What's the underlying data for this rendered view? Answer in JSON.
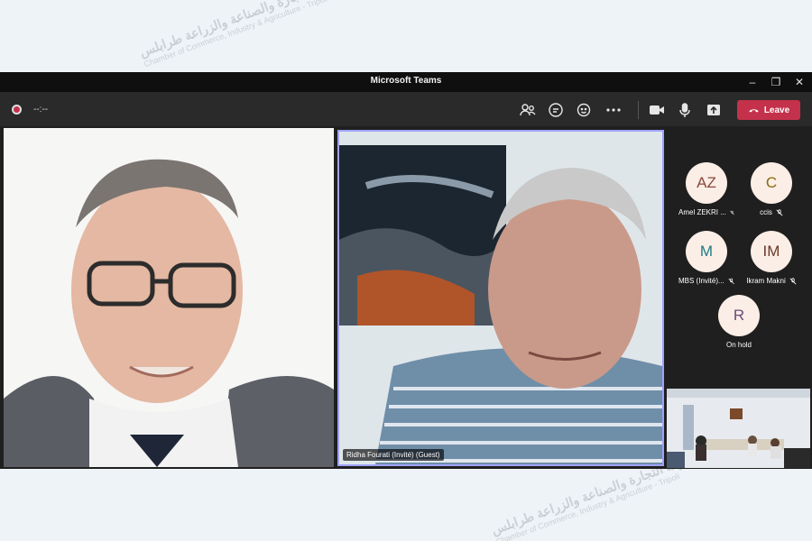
{
  "window": {
    "title": "Microsoft Teams"
  },
  "toolbar": {
    "timer": "--:--",
    "leave_label": "Leave",
    "icons": [
      "people-icon",
      "chat-icon",
      "reactions-icon",
      "more-icon",
      "camera-icon",
      "mic-icon",
      "share-icon"
    ]
  },
  "tiles": {
    "center_name": "Ridha Fourati (Invité) (Guest)"
  },
  "participants": [
    {
      "initials": "AZ",
      "name": "Amel ZEKRI ...",
      "color": "#8a4a3c",
      "muted": true
    },
    {
      "initials": "C",
      "name": "ccis",
      "color": "#8c6a12",
      "muted": true
    },
    {
      "initials": "M",
      "name": "MBS (Invité)...",
      "color": "#1f7a84",
      "muted": true
    },
    {
      "initials": "IM",
      "name": "Ikram Makni",
      "color": "#6b3a2a",
      "muted": true
    },
    {
      "initials": "R",
      "name": "On hold",
      "color": "#6a4a7a",
      "muted": false
    }
  ],
  "watermark": {
    "arabic": "غرفة التجارة والصناعة والزراعة طرابلس",
    "english": "Chamber of Commerce, Industry & Agriculture - Tripoli"
  },
  "colors": {
    "accent": "#c4314b",
    "active_border": "#9ea2ff"
  }
}
